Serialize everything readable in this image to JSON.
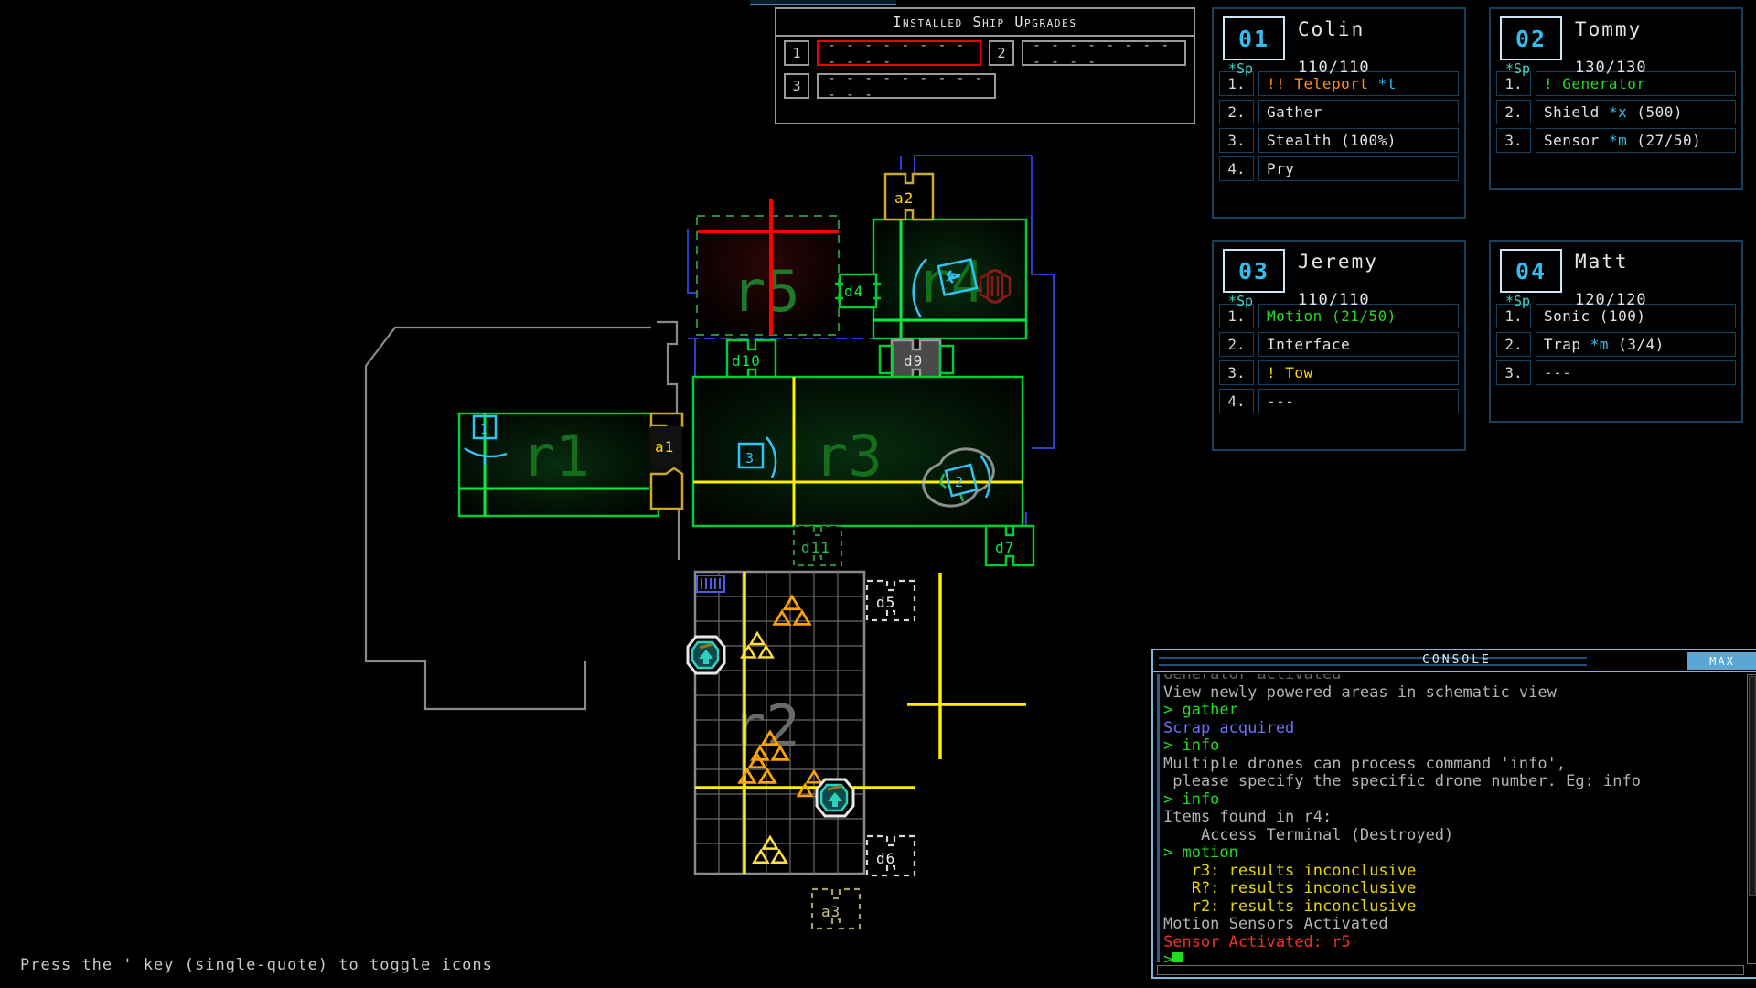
{
  "hint": {
    "text": "Press the ' key (single-quote) to toggle icons"
  },
  "upgrades": {
    "title": "Installed Ship Upgrades",
    "rows": [
      {
        "num": "1",
        "value": "- - - - - - - - - - - -",
        "selected": true
      },
      {
        "num": "2",
        "value": "- - - - - - - - - - - -",
        "selected": false
      },
      {
        "num": "3",
        "value": "- - - - - - - - - - - -",
        "selected": false
      }
    ]
  },
  "drones": [
    {
      "id": "01",
      "name": "Colin",
      "sp_label": "*Sp",
      "hp": "110/110",
      "slots": [
        {
          "n": "1.",
          "text": "!! Teleport *t",
          "parts": [
            {
              "t": "!! ",
              "c": "c-orange"
            },
            {
              "t": "Teleport ",
              "c": "c-orange"
            },
            {
              "t": "*t",
              "c": "c-cyan"
            }
          ]
        },
        {
          "n": "2.",
          "text": "Gather",
          "parts": [
            {
              "t": "Gather",
              "c": "c-white"
            }
          ]
        },
        {
          "n": "3.",
          "text": "Stealth (100%)",
          "parts": [
            {
              "t": "Stealth (100%)",
              "c": "c-white"
            }
          ]
        },
        {
          "n": "4.",
          "text": "Pry",
          "parts": [
            {
              "t": "Pry",
              "c": "c-white"
            }
          ]
        }
      ]
    },
    {
      "id": "02",
      "name": "Tommy",
      "sp_label": "*Sp",
      "hp": "130/130",
      "slots": [
        {
          "n": "1.",
          "text": "! Generator",
          "parts": [
            {
              "t": "! ",
              "c": "c-green"
            },
            {
              "t": "Generator",
              "c": "c-green"
            }
          ]
        },
        {
          "n": "2.",
          "text": "Shield *x (500)",
          "parts": [
            {
              "t": "Shield ",
              "c": "c-white"
            },
            {
              "t": "*x",
              "c": "c-cyan"
            },
            {
              "t": " (500)",
              "c": "c-white"
            }
          ]
        },
        {
          "n": "3.",
          "text": "Sensor *m (27/50)",
          "parts": [
            {
              "t": "Sensor ",
              "c": "c-white"
            },
            {
              "t": "*m",
              "c": "c-cyan"
            },
            {
              "t": " (27/50)",
              "c": "c-white"
            }
          ]
        }
      ]
    },
    {
      "id": "03",
      "name": "Jeremy",
      "sp_label": "*Sp",
      "hp": "110/110",
      "slots": [
        {
          "n": "1.",
          "text": "Motion (21/50)",
          "parts": [
            {
              "t": "Motion (21/50)",
              "c": "c-green"
            }
          ]
        },
        {
          "n": "2.",
          "text": "Interface",
          "parts": [
            {
              "t": "Interface",
              "c": "c-white"
            }
          ]
        },
        {
          "n": "3.",
          "text": "! Tow",
          "parts": [
            {
              "t": "! ",
              "c": "c-yellow"
            },
            {
              "t": "Tow",
              "c": "c-yellow"
            }
          ]
        },
        {
          "n": "4.",
          "text": "---",
          "parts": [
            {
              "t": "---",
              "c": "c-grey"
            }
          ]
        }
      ]
    },
    {
      "id": "04",
      "name": "Matt",
      "sp_label": "*Sp",
      "hp": "120/120",
      "slots": [
        {
          "n": "1.",
          "text": "Sonic (100)",
          "parts": [
            {
              "t": "Sonic (100)",
              "c": "c-white"
            }
          ]
        },
        {
          "n": "2.",
          "text": "Trap *m (3/4)",
          "parts": [
            {
              "t": "Trap ",
              "c": "c-white"
            },
            {
              "t": "*m",
              "c": "c-cyan"
            },
            {
              "t": " (3/4)",
              "c": "c-white"
            }
          ]
        },
        {
          "n": "3.",
          "text": "---",
          "parts": [
            {
              "t": "---",
              "c": "c-grey"
            }
          ]
        }
      ]
    }
  ],
  "console": {
    "title": "CONSOLE",
    "max_label": "MAX",
    "lines": [
      {
        "text": "Generator activated",
        "color": "grey",
        "clipped": true
      },
      {
        "text": "View newly powered areas in schematic view",
        "color": "grey"
      },
      {
        "text": "> gather",
        "color": "green"
      },
      {
        "text": "Scrap acquired",
        "color": "blue"
      },
      {
        "text": "> info",
        "color": "green"
      },
      {
        "text": "Multiple drones can process command 'info',",
        "color": "grey"
      },
      {
        "text": " please specify the specific drone number. Eg: info",
        "color": "grey"
      },
      {
        "text": "> info",
        "color": "green"
      },
      {
        "text": "Items found in r4:",
        "color": "grey"
      },
      {
        "text": "    Access Terminal (Destroyed)",
        "color": "grey"
      },
      {
        "text": "> motion",
        "color": "green"
      },
      {
        "text": "   r3: results inconclusive",
        "color": "yellow"
      },
      {
        "text": "   R?: results inconclusive",
        "color": "yellow"
      },
      {
        "text": "   r2: results inconclusive",
        "color": "yellow"
      },
      {
        "text": "Motion Sensors Activated",
        "color": "grey"
      },
      {
        "text": "Sensor Activated: r5",
        "color": "red"
      },
      {
        "text": ">",
        "color": "green",
        "caret": true
      }
    ]
  },
  "map": {
    "rooms": [
      {
        "name": "r1",
        "state": "powered",
        "color": "#00cc33"
      },
      {
        "name": "r2",
        "state": "unpowered",
        "color": "#808080"
      },
      {
        "name": "r3",
        "state": "powered",
        "color": "#00cc33"
      },
      {
        "name": "r4",
        "state": "powered",
        "color": "#00cc33"
      },
      {
        "name": "r5",
        "state": "sensed",
        "color": "#008822"
      }
    ],
    "doors": [
      "d4",
      "d5",
      "d6",
      "d7",
      "d9",
      "d10",
      "d11"
    ],
    "airlocks": [
      "a1",
      "a2",
      "a3"
    ],
    "crosshairs": [
      {
        "room": "r5",
        "color": "#ff0000"
      },
      {
        "room": "r1",
        "color": "#00ee44"
      },
      {
        "room": "r3",
        "color": "#ffee00"
      },
      {
        "room": "r2",
        "color": "#ffee00"
      }
    ],
    "drone_markers": [
      "1",
      "2",
      "3",
      "4"
    ],
    "scrap_count": 6,
    "beacon_count": 2
  }
}
